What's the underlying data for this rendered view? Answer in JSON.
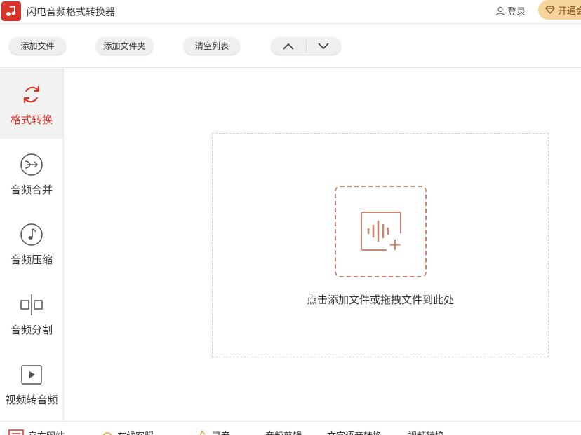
{
  "app": {
    "title": "闪电音频格式转换器",
    "login_label": "登录",
    "vip_label": "开通会员"
  },
  "toolbar": {
    "add_file": "添加文件",
    "add_folder": "添加文件夹",
    "clear_list": "清空列表"
  },
  "sidebar": {
    "items": [
      {
        "label": "格式转换",
        "icon": "refresh-icon",
        "active": true
      },
      {
        "label": "音频合并",
        "icon": "merge-icon",
        "active": false
      },
      {
        "label": "音频压缩",
        "icon": "music-note-icon",
        "active": false
      },
      {
        "label": "音频分割",
        "icon": "split-icon",
        "active": false
      },
      {
        "label": "视频转音频",
        "icon": "video-play-icon",
        "active": false
      }
    ]
  },
  "main": {
    "drop_hint": "点击添加文件或拖拽文件到此处"
  },
  "bottom": {
    "items": [
      {
        "label": "官方网站",
        "icon": "web-icon"
      },
      {
        "label": "在线客服",
        "icon": "headset-icon"
      },
      {
        "label": "录音",
        "icon": "mic-icon"
      },
      {
        "label": "音频剪辑",
        "icon": ""
      },
      {
        "label": "文字语音转换",
        "icon": ""
      },
      {
        "label": "视频转换",
        "icon": ""
      }
    ]
  },
  "colors": {
    "accent": "#d9342b",
    "upload_accent": "#c9876f",
    "vip_bg": "#f7d49a"
  }
}
